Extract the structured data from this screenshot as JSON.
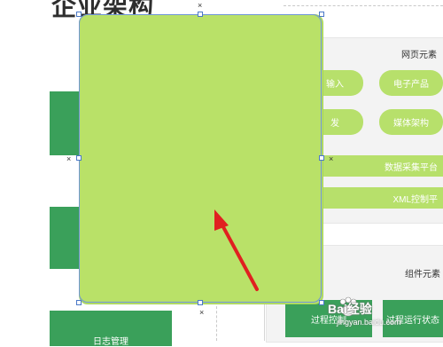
{
  "canvas": {
    "title": "企业架构"
  },
  "panel_web": {
    "title": "网页元素",
    "pills": [
      "输入",
      "电子产品",
      "发",
      "媒体架构"
    ],
    "bars": [
      "数据采集平台",
      "XML控制平"
    ]
  },
  "panel_component": {
    "title": "组件元素",
    "buttons": [
      "过程控制",
      "过程运行状态"
    ]
  },
  "left_bottom_block": {
    "label": "日志管理"
  },
  "watermark": {
    "brand": "Bai经验",
    "url": "jingyan.baidu.com"
  },
  "colors": {
    "selected_fill": "#b9e168",
    "dark_green": "#3aa05a",
    "light_green": "#b7e06b",
    "arrow": "#e02020",
    "handle_border": "#4a78c7"
  }
}
